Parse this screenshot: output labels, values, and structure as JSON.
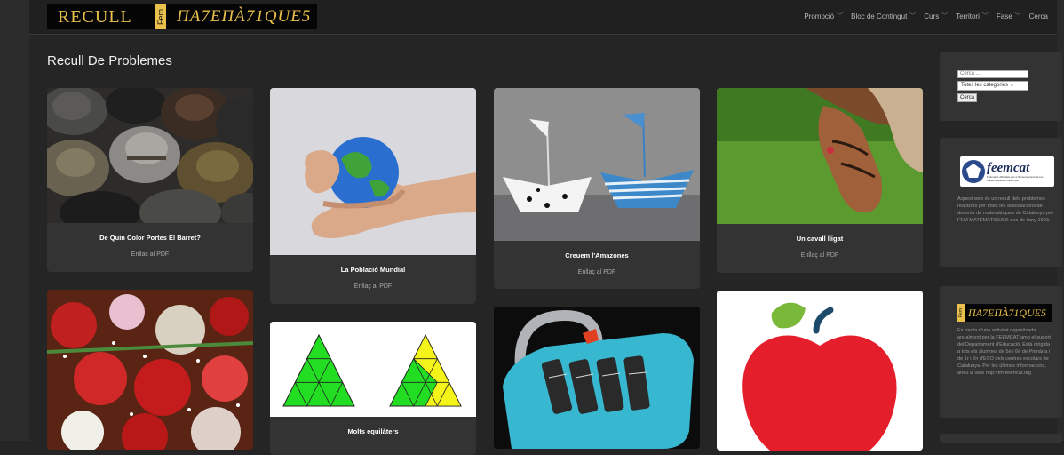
{
  "header": {
    "logo_left": "RECULL",
    "logo_fem": "Fem",
    "logo_right": "ΠΑ7ΕΠÀ71QUE5",
    "nav": [
      {
        "label": "Promoció"
      },
      {
        "label": "Bloc de Contingut"
      },
      {
        "label": "Curs"
      },
      {
        "label": "Territori"
      },
      {
        "label": "Fase"
      },
      {
        "label": "Cerca"
      }
    ]
  },
  "page_title": "Recull De Problemes",
  "cards": [
    {
      "title": "De Quin Color Portes El Barret?",
      "link": "Enllaç al PDF",
      "image": "hats-photo"
    },
    {
      "title": "La Població Mundial",
      "link": "Enllaç al PDF",
      "image": "globe-stress-ball-photo"
    },
    {
      "title": "Creuem l'Amazones",
      "link": "Enllaç al PDF",
      "image": "paper-boats-photo"
    },
    {
      "title": "Un cavall lligat",
      "link": "Enllaç al PDF",
      "image": "horse-photo"
    },
    {
      "title": "",
      "link": "",
      "image": "flowers-photo"
    },
    {
      "title": "Molts equilàters",
      "link": "",
      "image": "equilateral-triangles-figure"
    },
    {
      "title": "",
      "link": "",
      "image": "combination-padlock-photo"
    },
    {
      "title": "",
      "link": "",
      "image": "red-apple-illustration"
    }
  ],
  "sidebar": {
    "search_placeholder": "Cerca ...",
    "category_select": "Totes les categories",
    "search_button": "Cerca",
    "feemcat_logo": "feemcat",
    "feemcat_subtitle": "Federació d'Entitats per a l'Ensenyament de les Matemàtiques a Catalunya",
    "feemcat_text": "Aquest web és un recull dels problemes realitzats per totes les associacions de docents de matemàtiques de Catalunya pel FEM MATEMÀTIQUES des de l'any 1993.",
    "fem_logo_fem": "Fem",
    "fem_logo_text": "ΠΑ7ΕΠÀ71QUE5",
    "fem_text": "Es tracta d'una activitat organitzada anualment per la FEEMCAT amb el suport del Departament d'Educació. Està dirigida a tots els alumnes de 5è i 6è de Primària i de 1r i 2n d'ESO dels centres escolars de Catalunya. Per les últimes informacions, aneu al web http://fm.feemcat.org"
  },
  "colors": {
    "accent": "#e9c04c",
    "background": "#252525",
    "card": "#333333"
  }
}
